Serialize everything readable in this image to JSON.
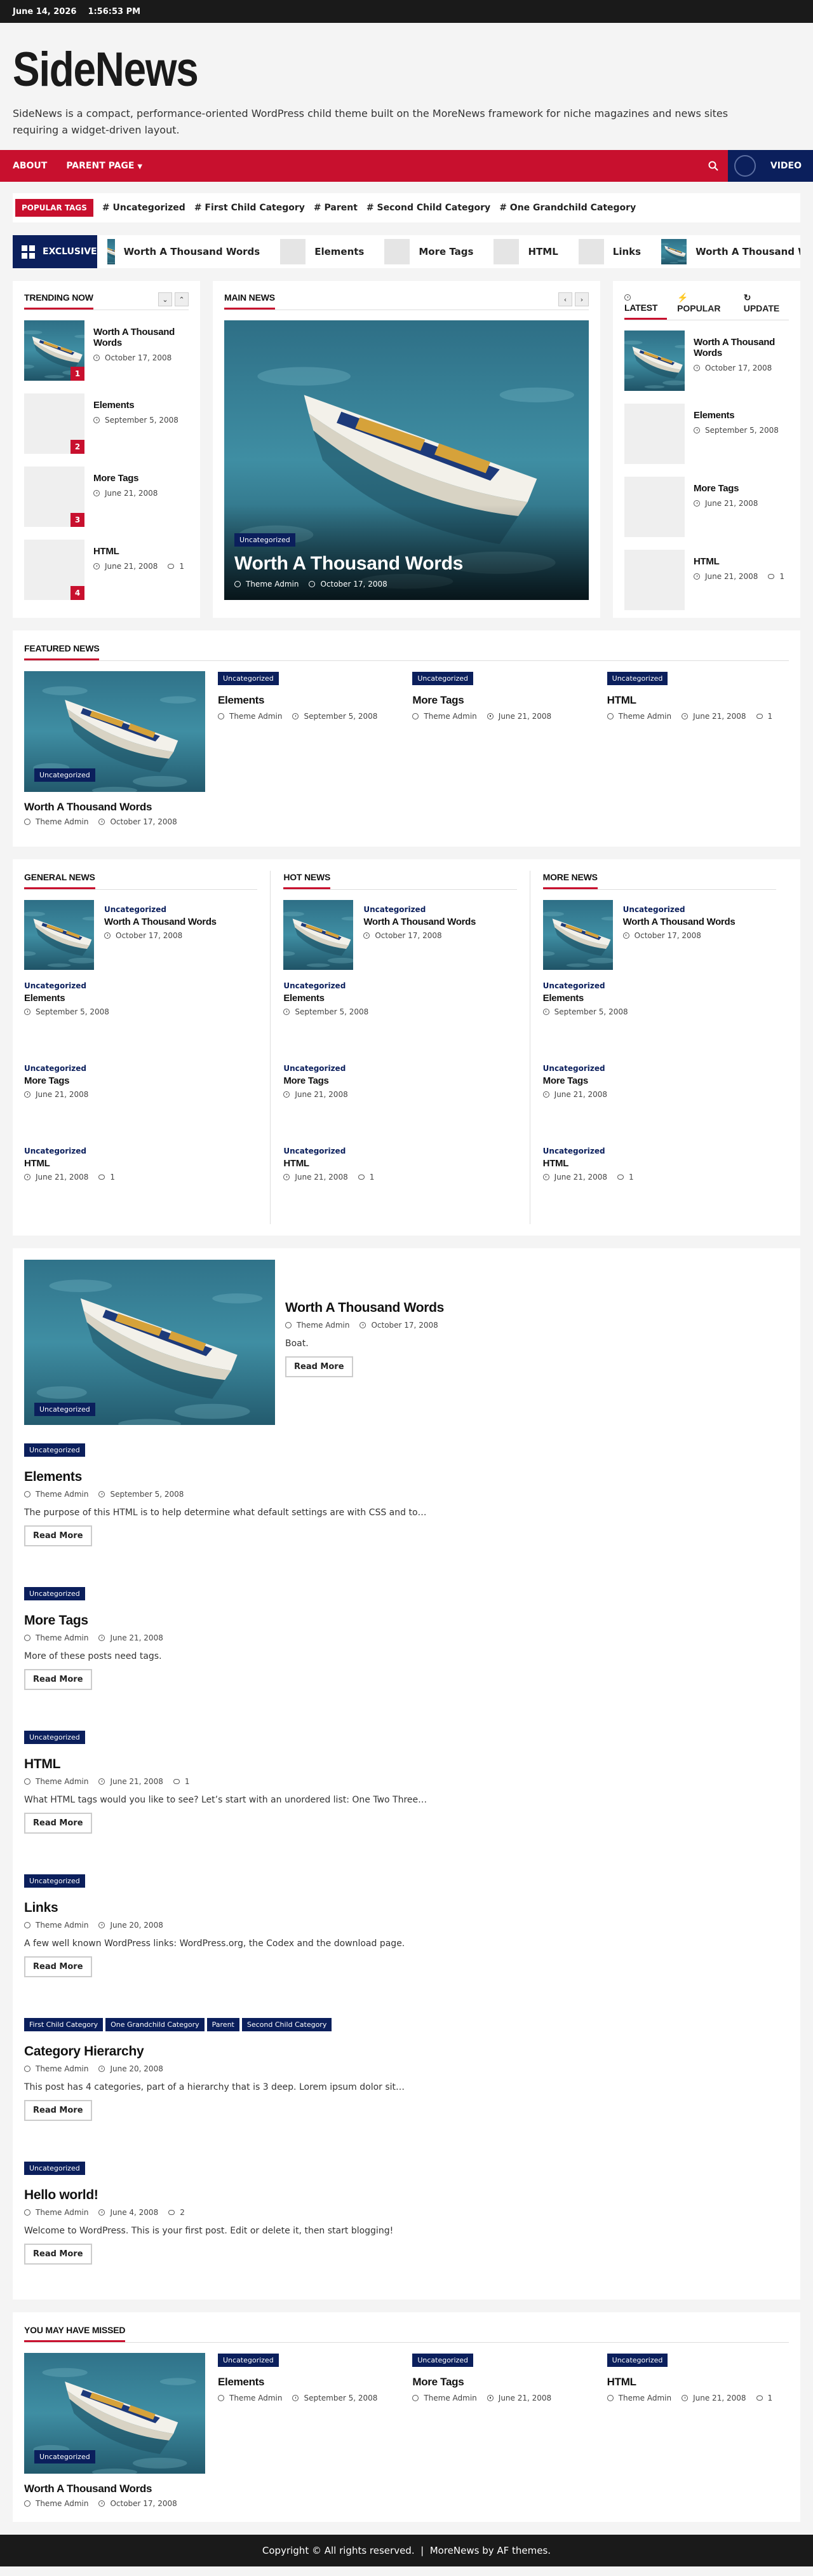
{
  "topbar": {
    "date": "June 14, 2026",
    "time": "1:56:53 PM"
  },
  "site": {
    "title": "SideNews",
    "tagline": "SideNews is a compact, performance-oriented WordPress child theme built on the MoreNews framework for niche magazines and news sites requiring a widget-driven layout."
  },
  "nav": {
    "items": [
      "ABOUT",
      "PARENT PAGE"
    ],
    "video_label": "VIDEO"
  },
  "tags": {
    "label": "POPULAR TAGS",
    "items": [
      "# Uncategorized",
      "# First Child Category",
      "# Parent",
      "# Second Child Category",
      "# One Grandchild Category"
    ]
  },
  "exclusive": {
    "label": "EXCLUSIVE",
    "items": [
      "Worth A Thousand Words",
      "Elements",
      "More Tags",
      "HTML",
      "Links",
      "Worth A Thousand Words"
    ]
  },
  "trending": {
    "title": "TRENDING NOW",
    "items": [
      {
        "title": "Worth A Thousand Words",
        "date": "October 17, 2008",
        "rank": "1"
      },
      {
        "title": "Elements",
        "date": "September 5, 2008",
        "rank": "2"
      },
      {
        "title": "More Tags",
        "date": "June 21, 2008",
        "rank": "3"
      },
      {
        "title": "HTML",
        "date": "June 21, 2008",
        "comments": "1",
        "rank": "4"
      }
    ]
  },
  "main_news": {
    "title": "MAIN NEWS",
    "badge": "Uncategorized",
    "headline": "Worth A Thousand Words",
    "author": "Theme Admin",
    "date": "October 17, 2008"
  },
  "side_tabs": {
    "tabs": [
      "LATEST",
      "POPULAR",
      "UPDATE"
    ],
    "items": [
      {
        "title": "Worth A Thousand Words",
        "date": "October 17, 2008"
      },
      {
        "title": "Elements",
        "date": "September 5, 2008"
      },
      {
        "title": "More Tags",
        "date": "June 21, 2008"
      },
      {
        "title": "HTML",
        "date": "June 21, 2008",
        "comments": "1"
      }
    ]
  },
  "featured": {
    "title": "FEATURED NEWS",
    "main": {
      "badge": "Uncategorized",
      "title": "Worth A Thousand Words",
      "author": "Theme Admin",
      "date": "October 17, 2008"
    },
    "items": [
      {
        "badge": "Uncategorized",
        "title": "Elements",
        "author": "Theme Admin",
        "date": "September 5, 2008"
      },
      {
        "badge": "Uncategorized",
        "title": "More Tags",
        "author": "Theme Admin",
        "date": "June 21, 2008"
      },
      {
        "badge": "Uncategorized",
        "title": "HTML",
        "author": "Theme Admin",
        "date": "June 21, 2008",
        "comments": "1"
      }
    ]
  },
  "columns": [
    {
      "title": "GENERAL NEWS"
    },
    {
      "title": "HOT NEWS"
    },
    {
      "title": "MORE NEWS"
    }
  ],
  "column_posts": [
    {
      "cat": "Uncategorized",
      "title": "Worth A Thousand Words",
      "date": "October 17, 2008"
    },
    {
      "cat": "Uncategorized",
      "title": "Elements",
      "date": "September 5, 2008"
    },
    {
      "cat": "Uncategorized",
      "title": "More Tags",
      "date": "June 21, 2008"
    },
    {
      "cat": "Uncategorized",
      "title": "HTML",
      "date": "June 21, 2008",
      "comments": "1"
    }
  ],
  "list": {
    "read_more": "Read More",
    "posts": [
      {
        "cats": [
          "Uncategorized"
        ],
        "title": "Worth A Thousand Words",
        "author": "Theme Admin",
        "date": "October 17, 2008",
        "excerpt": "Boat."
      },
      {
        "cats": [
          "Uncategorized"
        ],
        "title": "Elements",
        "author": "Theme Admin",
        "date": "September 5, 2008",
        "excerpt": "The purpose of this HTML is to help determine what default settings are with CSS and to…"
      },
      {
        "cats": [
          "Uncategorized"
        ],
        "title": "More Tags",
        "author": "Theme Admin",
        "date": "June 21, 2008",
        "excerpt": "More of these posts need tags."
      },
      {
        "cats": [
          "Uncategorized"
        ],
        "title": "HTML",
        "author": "Theme Admin",
        "date": "June 21, 2008",
        "comments": "1",
        "excerpt": "What HTML tags would you like to see? Let’s start with an unordered list: One Two Three…"
      },
      {
        "cats": [
          "Uncategorized"
        ],
        "title": "Links",
        "author": "Theme Admin",
        "date": "June 20, 2008",
        "excerpt": "A few well known WordPress links: WordPress.org, the Codex and the download page."
      },
      {
        "cats": [
          "First Child Category",
          "One Grandchild Category",
          "Parent",
          "Second Child Category"
        ],
        "title": "Category Hierarchy",
        "author": "Theme Admin",
        "date": "June 20, 2008",
        "excerpt": "This post has 4 categories, part of a hierarchy that is 3 deep. Lorem ipsum dolor sit…"
      },
      {
        "cats": [
          "Uncategorized"
        ],
        "title": "Hello world!",
        "author": "Theme Admin",
        "date": "June 4, 2008",
        "comments": "2",
        "excerpt": "Welcome to WordPress. This is your first post. Edit or delete it, then start blogging!"
      }
    ]
  },
  "missed": {
    "title": "YOU MAY HAVE MISSED"
  },
  "footer": {
    "text": "Copyright © All rights reserved.  |  MoreNews by AF themes."
  },
  "colors": {
    "accent": "#c8102e",
    "navy": "#0b1f5c"
  }
}
